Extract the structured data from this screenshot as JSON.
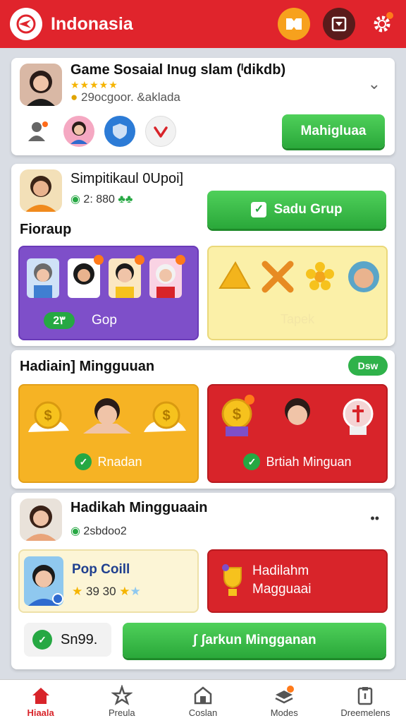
{
  "header": {
    "title": "Indonasia",
    "icons": [
      "logo-icon",
      "puzzle-icon",
      "calendar-icon",
      "gear-icon"
    ]
  },
  "card1": {
    "title": "Game Sosaial Inug slam (ˡdikdb)",
    "stars": "★★★★★",
    "subtitle": "29ocgoor. &aklada",
    "button": "Mahigluaa"
  },
  "card2": {
    "title": "Simpitikaul 0Upoi]",
    "subtitle": "2: 880",
    "button": "Sadu Grup",
    "section": "Fioraup",
    "tile_left_count": "2٣",
    "tile_left_label": "Gop",
    "tile_right_label": "Tapek",
    "icons": [
      "triangle-icon",
      "tools-icon",
      "flower-icon",
      "avatar-icon"
    ]
  },
  "card3": {
    "title": "Hadiain] Mingguuan",
    "pill": "Dsw",
    "tile_left_label": "Rnadan",
    "tile_right_label": "Brtiah Minguan"
  },
  "card4": {
    "title": "Hadikah Mingguaain",
    "subtitle": "2sbdoo2",
    "more": "••",
    "tile_left_title": "Pop Coill",
    "tile_left_sub": "39 30",
    "tile_right_line1": "Hadilahm",
    "tile_right_line2": "Magguaai",
    "count": "Sn99.",
    "button": "ʃ ʃarkun Mingganan"
  },
  "nav": [
    {
      "label": "Hiaala",
      "icon": "home-icon",
      "active": true
    },
    {
      "label": "Preula",
      "icon": "star-icon",
      "active": false
    },
    {
      "label": "Coslan",
      "icon": "store-icon",
      "active": false
    },
    {
      "label": "Modes",
      "icon": "layers-icon",
      "active": false
    },
    {
      "label": "Dreemelens",
      "icon": "clipboard-icon",
      "active": false
    }
  ],
  "colors": {
    "brand_red": "#e0242c",
    "green": "#2aa83a",
    "purple": "#7e4fc9",
    "gold": "#f6b324"
  }
}
